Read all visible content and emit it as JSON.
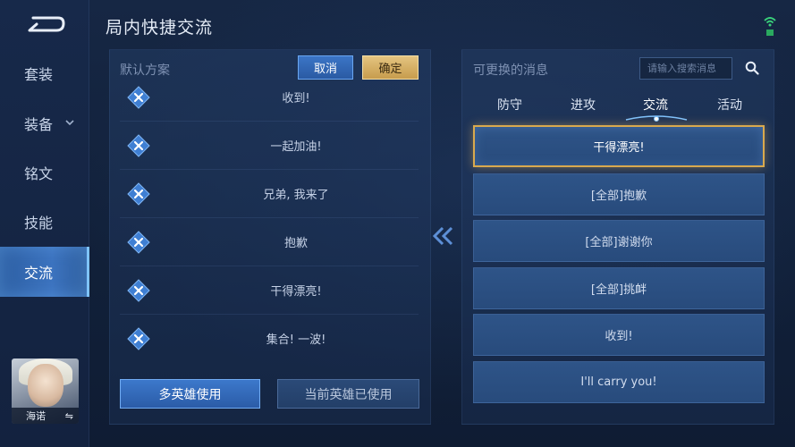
{
  "header": {
    "title": "局内快捷交流"
  },
  "nav": {
    "items": [
      {
        "label": "套装"
      },
      {
        "label": "装备",
        "has_dropdown": true
      },
      {
        "label": "铭文"
      },
      {
        "label": "技能"
      },
      {
        "label": "交流",
        "active": true
      }
    ],
    "hero": {
      "name": "海诺",
      "swap_icon": "⇋"
    }
  },
  "left_panel": {
    "label": "默认方案",
    "cancel_label": "取消",
    "confirm_label": "确定",
    "messages": [
      "收到!",
      "一起加油!",
      "兄弟, 我来了",
      "抱歉",
      "干得漂亮!",
      "集合! 一波!"
    ],
    "multi_hero_label": "多英雄使用",
    "current_hero_label": "当前英雄已使用"
  },
  "right_panel": {
    "label": "可更换的消息",
    "search_placeholder": "请输入搜索消息",
    "tabs": [
      {
        "label": "防守"
      },
      {
        "label": "进攻"
      },
      {
        "label": "交流",
        "active": true
      },
      {
        "label": "活动"
      }
    ],
    "messages": [
      "干得漂亮!",
      "[全部]抱歉",
      "[全部]谢谢你",
      "[全部]挑衅",
      "收到!",
      "I'll carry you!"
    ],
    "selected_index": 0
  },
  "colors": {
    "background": "#13213c",
    "accent_blue": "#3c78cb",
    "accent_gold": "#d9a94e",
    "remove_icon": "#4f8fe0"
  }
}
